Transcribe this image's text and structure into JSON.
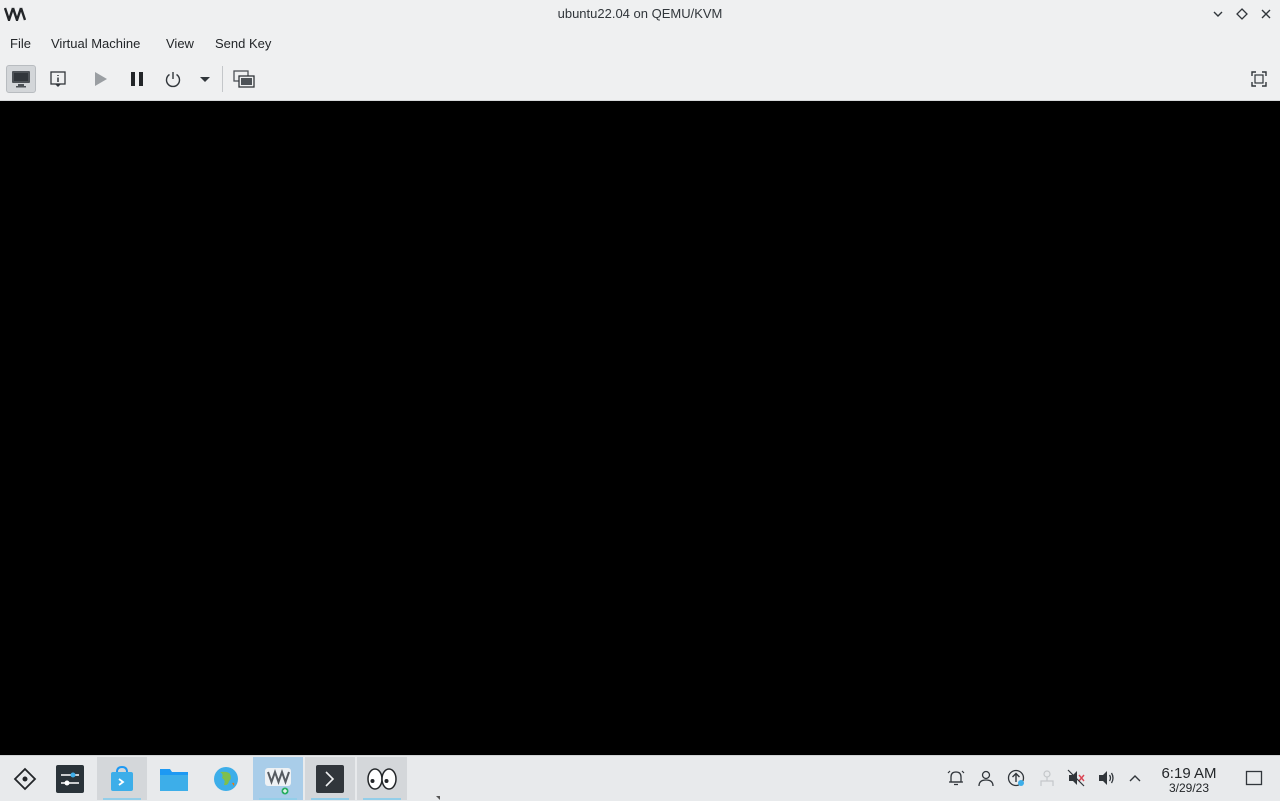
{
  "window": {
    "title": "ubuntu22.04 on QEMU/KVM",
    "app_icon": "virt-manager-logo"
  },
  "titlebar_buttons": [
    "minimize",
    "keep-above",
    "close"
  ],
  "menu": [
    "File",
    "Virtual Machine",
    "View",
    "Send Key"
  ],
  "toolbar": {
    "buttons": [
      "show-graphical-console",
      "show-virtual-hardware-details",
      "run",
      "pause",
      "shut-down",
      "shutdown-options",
      "manage-snapshots",
      "fullscreen"
    ]
  },
  "console": {
    "background": "#000000"
  },
  "taskbar": {
    "apps": [
      "application-launcher",
      "system-settings",
      "discover",
      "file-manager",
      "web-browser",
      "virtual-machine-manager",
      "terminal",
      "eyes"
    ],
    "tray": [
      "notifications",
      "user",
      "updates",
      "network",
      "muted",
      "volume",
      "show-hidden"
    ],
    "clock": {
      "time": "6:19 AM",
      "date": "3/29/23"
    }
  },
  "colors": {
    "chrome": "#eff0f1",
    "taskbar": "#e8eaec",
    "focused_task": "#a9cde9",
    "accent": "#3daee9"
  }
}
